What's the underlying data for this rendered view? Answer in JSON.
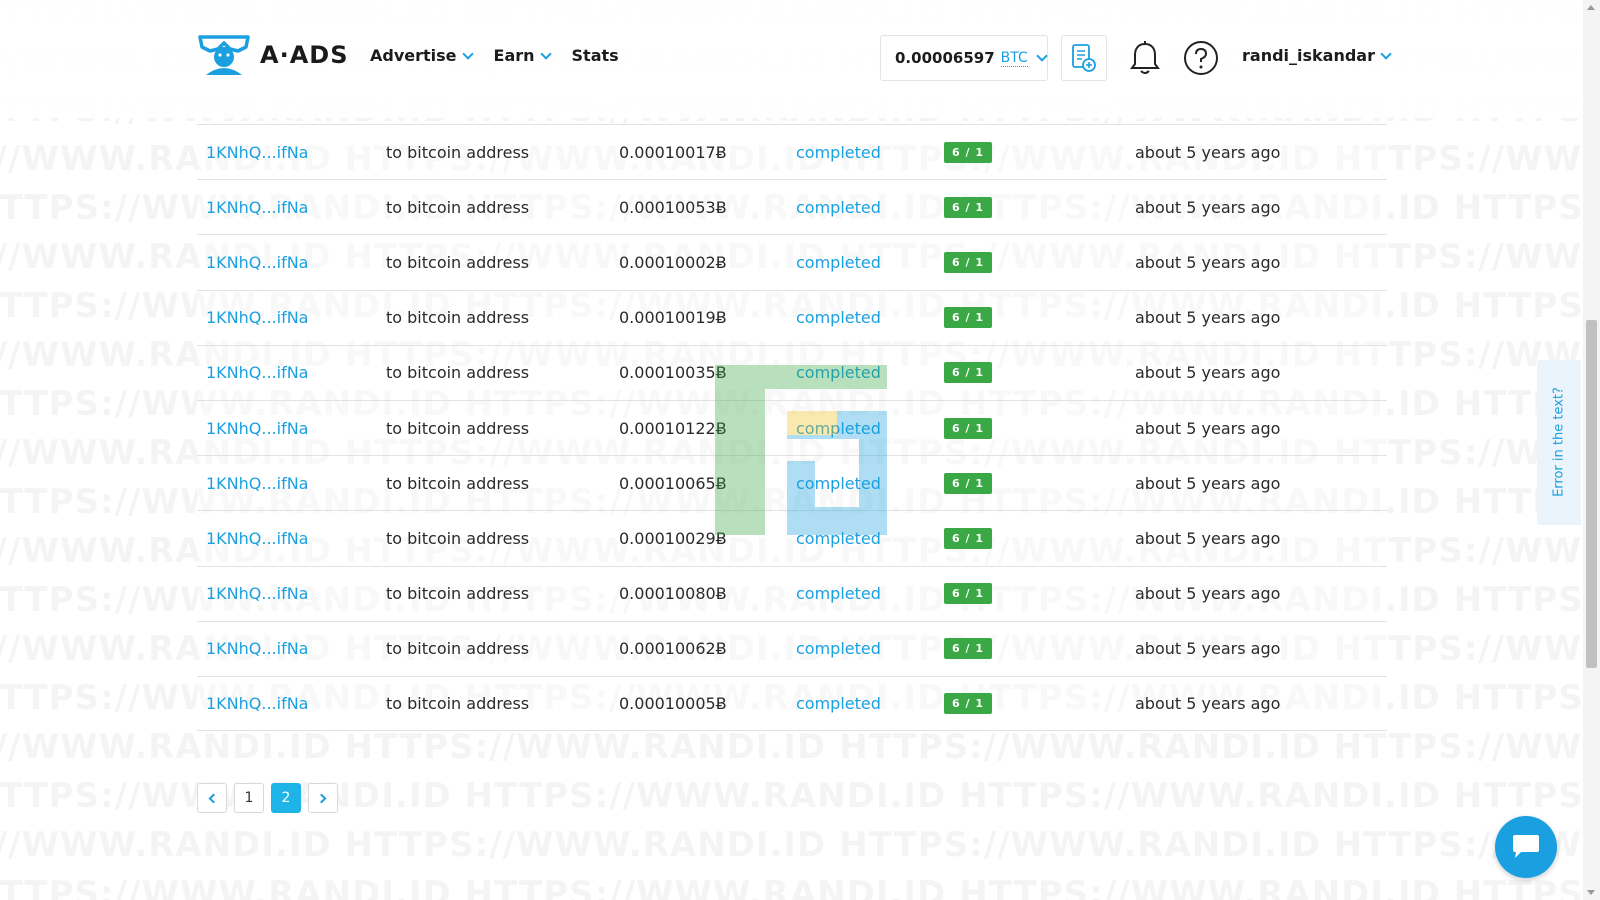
{
  "watermark_text": "HTTPS://WWW.RANDI.ID",
  "header": {
    "logo_text": "A·ADS",
    "nav": [
      "Advertise",
      "Earn",
      "Stats"
    ],
    "balance_value": "0.00006597",
    "balance_currency": "BTC",
    "username": "randi_iskandar"
  },
  "transactions": [
    {
      "address": "1KNhQ...ifNa",
      "destination": "to bitcoin address",
      "amount": "0.00010017Ƀ",
      "status": "completed",
      "badge": "6 / 1",
      "time": "about 5 years ago"
    },
    {
      "address": "1KNhQ...ifNa",
      "destination": "to bitcoin address",
      "amount": "0.00010053Ƀ",
      "status": "completed",
      "badge": "6 / 1",
      "time": "about 5 years ago"
    },
    {
      "address": "1KNhQ...ifNa",
      "destination": "to bitcoin address",
      "amount": "0.00010002Ƀ",
      "status": "completed",
      "badge": "6 / 1",
      "time": "about 5 years ago"
    },
    {
      "address": "1KNhQ...ifNa",
      "destination": "to bitcoin address",
      "amount": "0.00010019Ƀ",
      "status": "completed",
      "badge": "6 / 1",
      "time": "about 5 years ago"
    },
    {
      "address": "1KNhQ...ifNa",
      "destination": "to bitcoin address",
      "amount": "0.00010035Ƀ",
      "status": "completed",
      "badge": "6 / 1",
      "time": "about 5 years ago"
    },
    {
      "address": "1KNhQ...ifNa",
      "destination": "to bitcoin address",
      "amount": "0.00010122Ƀ",
      "status": "completed",
      "badge": "6 / 1",
      "time": "about 5 years ago"
    },
    {
      "address": "1KNhQ...ifNa",
      "destination": "to bitcoin address",
      "amount": "0.00010065Ƀ",
      "status": "completed",
      "badge": "6 / 1",
      "time": "about 5 years ago"
    },
    {
      "address": "1KNhQ...ifNa",
      "destination": "to bitcoin address",
      "amount": "0.00010029Ƀ",
      "status": "completed",
      "badge": "6 / 1",
      "time": "about 5 years ago"
    },
    {
      "address": "1KNhQ...ifNa",
      "destination": "to bitcoin address",
      "amount": "0.00010080Ƀ",
      "status": "completed",
      "badge": "6 / 1",
      "time": "about 5 years ago"
    },
    {
      "address": "1KNhQ...ifNa",
      "destination": "to bitcoin address",
      "amount": "0.00010062Ƀ",
      "status": "completed",
      "badge": "6 / 1",
      "time": "about 5 years ago"
    },
    {
      "address": "1KNhQ...ifNa",
      "destination": "to bitcoin address",
      "amount": "0.00010005Ƀ",
      "status": "completed",
      "badge": "6 / 1",
      "time": "about 5 years ago"
    }
  ],
  "pagination": {
    "pages": [
      "1",
      "2"
    ],
    "current": "2"
  },
  "side_tab_label": "Error in the text?",
  "colors": {
    "accent": "#1aa0e0",
    "badge_green": "#3aa845",
    "page_active": "#1eb4e8"
  }
}
